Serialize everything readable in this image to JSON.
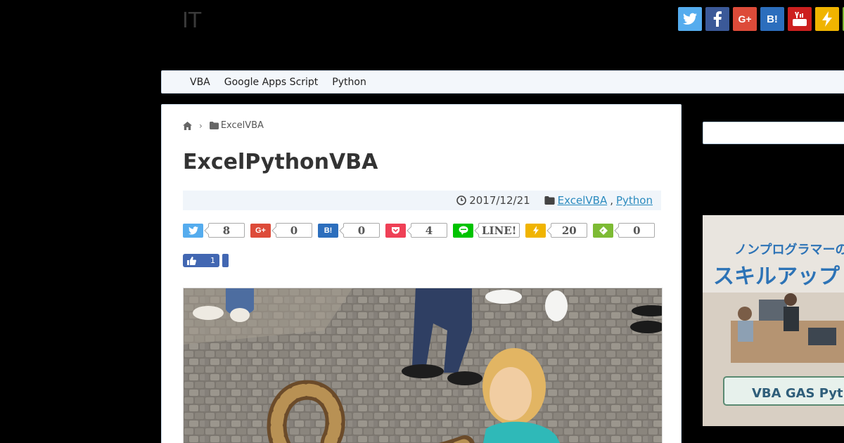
{
  "site": {
    "title": "IT"
  },
  "social_top": [
    {
      "name": "twitter",
      "color": "#55acee"
    },
    {
      "name": "facebook",
      "color": "#3b5998"
    },
    {
      "name": "google-plus",
      "color": "#dd4b39",
      "label": "G+"
    },
    {
      "name": "hatena",
      "color": "#2c6ebd",
      "label": "B!"
    },
    {
      "name": "youtube",
      "color": "#cd201f"
    },
    {
      "name": "feedly",
      "color": "#f0b400"
    }
  ],
  "nav": {
    "items": [
      "VBA",
      "Google Apps Script",
      "Python"
    ]
  },
  "breadcrumb": {
    "category": "ExcelVBA"
  },
  "post": {
    "title": "ExcelPythonVBA",
    "date": "2017/12/21",
    "categories": [
      "ExcelVBA",
      "Python"
    ]
  },
  "share": {
    "twitter": "8",
    "google_plus": "0",
    "hatena": "0",
    "pocket": "4",
    "line": "LINE!",
    "feedly": "20",
    "evernote": "0"
  },
  "like": {
    "count": "1"
  },
  "ad": {
    "headline": "ノンプログラマーの",
    "subhead": "スキルアップ",
    "footer": "VBA GAS Pytho"
  }
}
